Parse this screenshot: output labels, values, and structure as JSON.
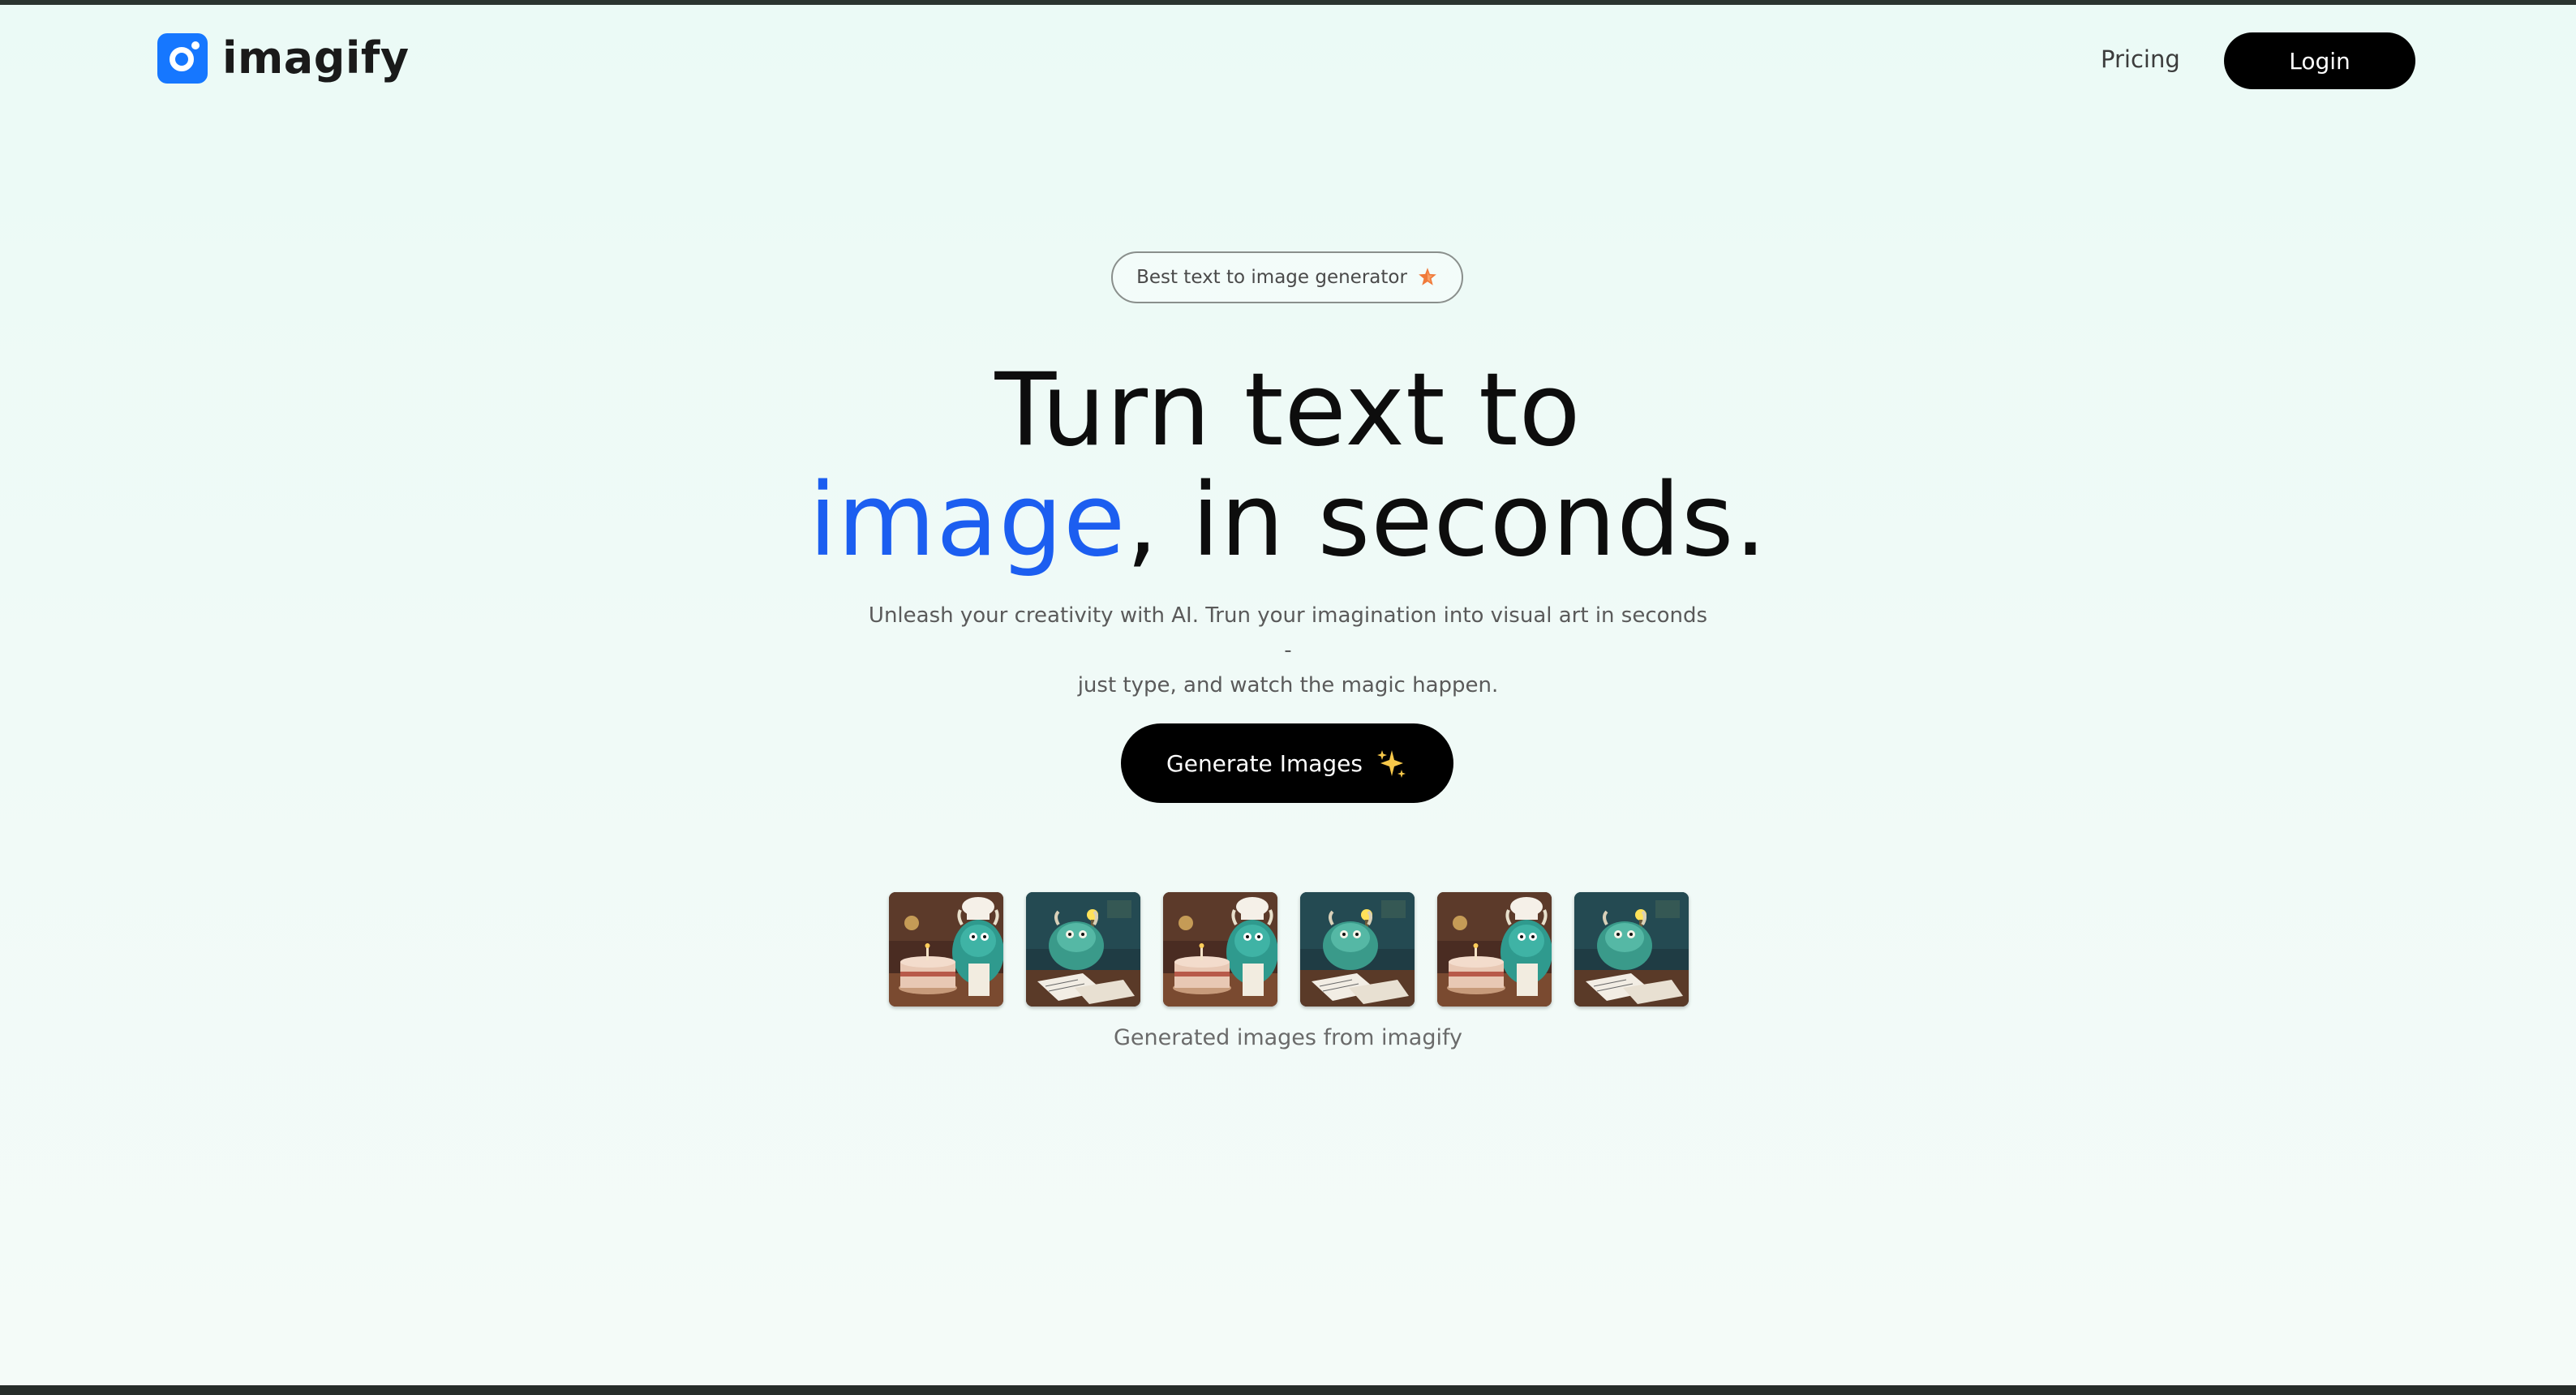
{
  "brand": {
    "name": "imagify",
    "accent_color": "#1677ff",
    "logo_icon": "camera-lens-icon"
  },
  "nav": {
    "pricing_label": "Pricing",
    "login_label": "Login"
  },
  "badge": {
    "text": "Best text to image generator",
    "icon": "star-icon",
    "icon_color": "#f07a3a"
  },
  "hero": {
    "line1": "Turn text to",
    "line2_accent": "image",
    "line2_rest": ", in seconds.",
    "accent_color": "#1c5ef0",
    "subtitle_line1": "Unleash your creativity with AI. Trun your imagination into visual art in seconds -",
    "subtitle_line2": "just type, and watch the magic happen."
  },
  "cta": {
    "label": "Generate Images",
    "icon": "sparkles-icon"
  },
  "gallery": {
    "items": [
      {
        "subject": "monster-chef-with-cake"
      },
      {
        "subject": "monster-at-desk-with-lamp"
      },
      {
        "subject": "monster-chef-with-cake"
      },
      {
        "subject": "monster-at-desk-with-lamp"
      },
      {
        "subject": "monster-chef-with-cake"
      },
      {
        "subject": "monster-at-desk-with-lamp"
      }
    ],
    "caption": "Generated images from imagify"
  }
}
